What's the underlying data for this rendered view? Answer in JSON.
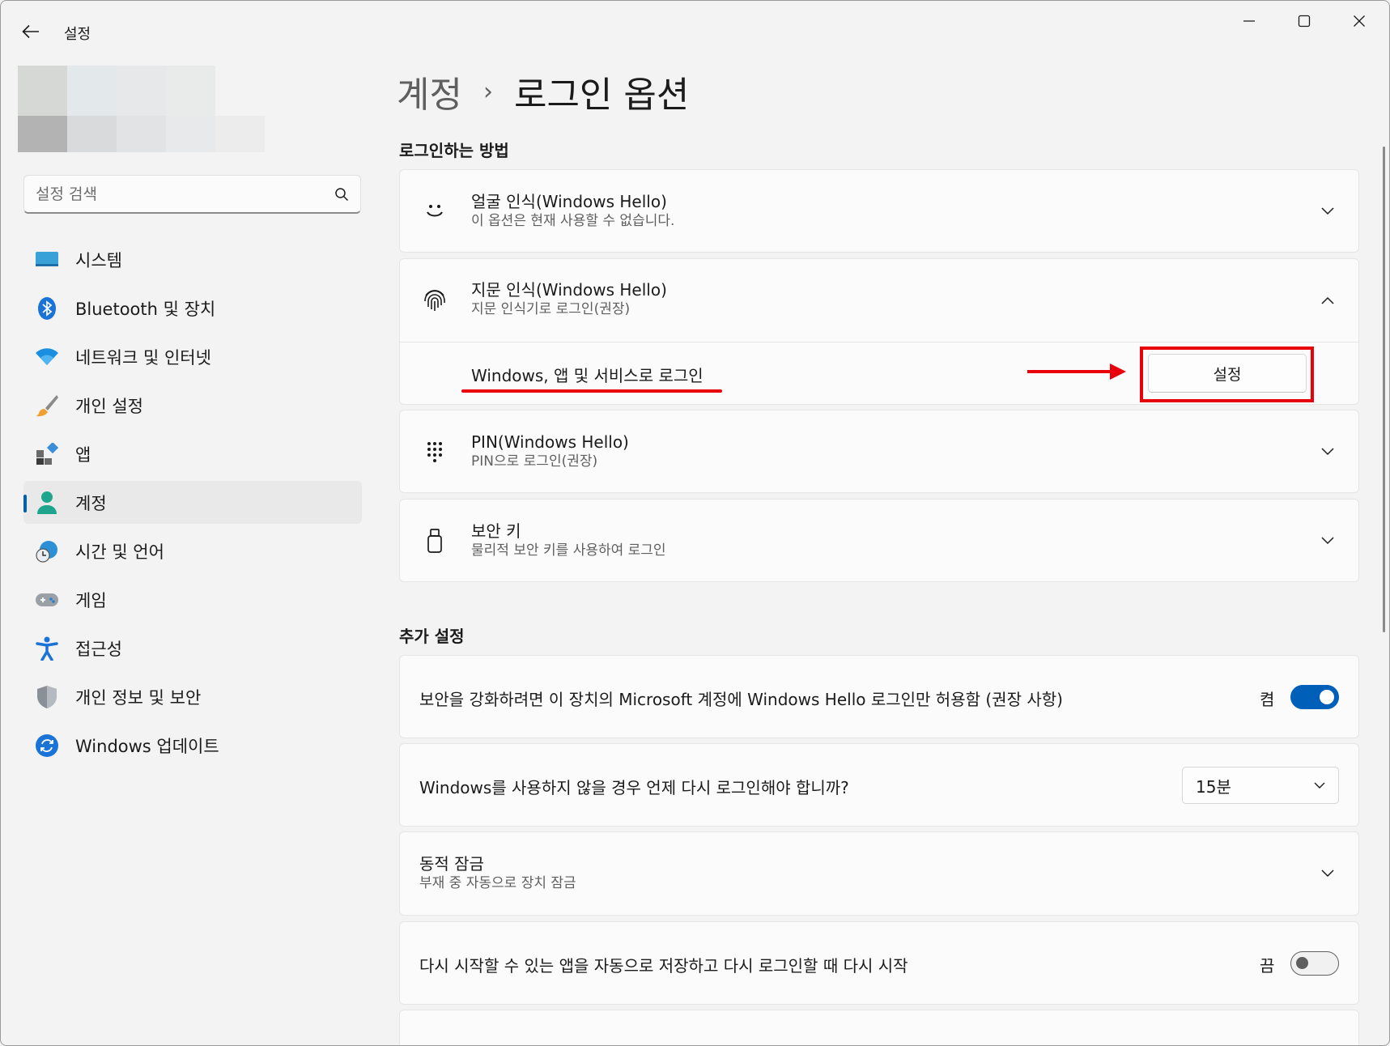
{
  "window": {
    "title": "설정",
    "controls": {
      "minimize": "minimize-icon",
      "maximize": "maximize-icon",
      "close": "close-icon"
    }
  },
  "sidebar": {
    "search": {
      "placeholder": "설정 검색",
      "value": ""
    },
    "items": [
      {
        "label": "시스템",
        "icon": "system-icon",
        "active": false
      },
      {
        "label": "Bluetooth 및 장치",
        "icon": "bluetooth-icon",
        "active": false
      },
      {
        "label": "네트워크 및 인터넷",
        "icon": "wifi-icon",
        "active": false
      },
      {
        "label": "개인 설정",
        "icon": "brush-icon",
        "active": false
      },
      {
        "label": "앱",
        "icon": "apps-icon",
        "active": false
      },
      {
        "label": "계정",
        "icon": "account-icon",
        "active": true
      },
      {
        "label": "시간 및 언어",
        "icon": "clock-globe-icon",
        "active": false
      },
      {
        "label": "게임",
        "icon": "gamepad-icon",
        "active": false
      },
      {
        "label": "접근성",
        "icon": "accessibility-icon",
        "active": false
      },
      {
        "label": "개인 정보 및 보안",
        "icon": "shield-icon",
        "active": false
      },
      {
        "label": "Windows 업데이트",
        "icon": "update-icon",
        "active": false
      }
    ]
  },
  "breadcrumb": {
    "parent": "계정",
    "separator": "›",
    "current": "로그인 옵션"
  },
  "signin_methods": {
    "heading": "로그인하는 방법",
    "face": {
      "title": "얼굴 인식(Windows Hello)",
      "subtitle": "이 옵션은 현재 사용할 수 없습니다.",
      "icon": "face-icon"
    },
    "fingerprint": {
      "title": "지문 인식(Windows Hello)",
      "subtitle": "지문 인식기로 로그인(권장)",
      "icon": "fingerprint-icon",
      "expanded": true,
      "detail_label": "Windows, 앱 및 서비스로 로그인",
      "button_label": "설정"
    },
    "pin": {
      "title": "PIN(Windows Hello)",
      "subtitle": "PIN으로 로그인(권장)",
      "icon": "pin-keypad-icon"
    },
    "security_key": {
      "title": "보안 키",
      "subtitle": "물리적 보안 키를 사용하여 로그인",
      "icon": "usb-key-icon"
    }
  },
  "additional": {
    "heading": "추가 설정",
    "hello_only": {
      "label": "보안을 강화하려면 이 장치의 Microsoft 계정에 Windows Hello 로그인만 허용함 (권장 사항)",
      "state": "켬",
      "on": true
    },
    "require_signin": {
      "label": "Windows를 사용하지 않을 경우 언제 다시 로그인해야 합니까?",
      "value": "15분"
    },
    "dynamic_lock": {
      "title": "동적 잠금",
      "subtitle": "부재 중 자동으로 장치 잠금"
    },
    "restart_apps": {
      "label": "다시 시작할 수 있는 앱을 자동으로 저장하고 다시 로그인할 때 다시 시작",
      "state": "끔",
      "on": false
    }
  },
  "colors": {
    "accent": "#005fb8",
    "annotation": "#e8000b",
    "background": "#f3f3f3",
    "card": "#fbfbfb"
  }
}
